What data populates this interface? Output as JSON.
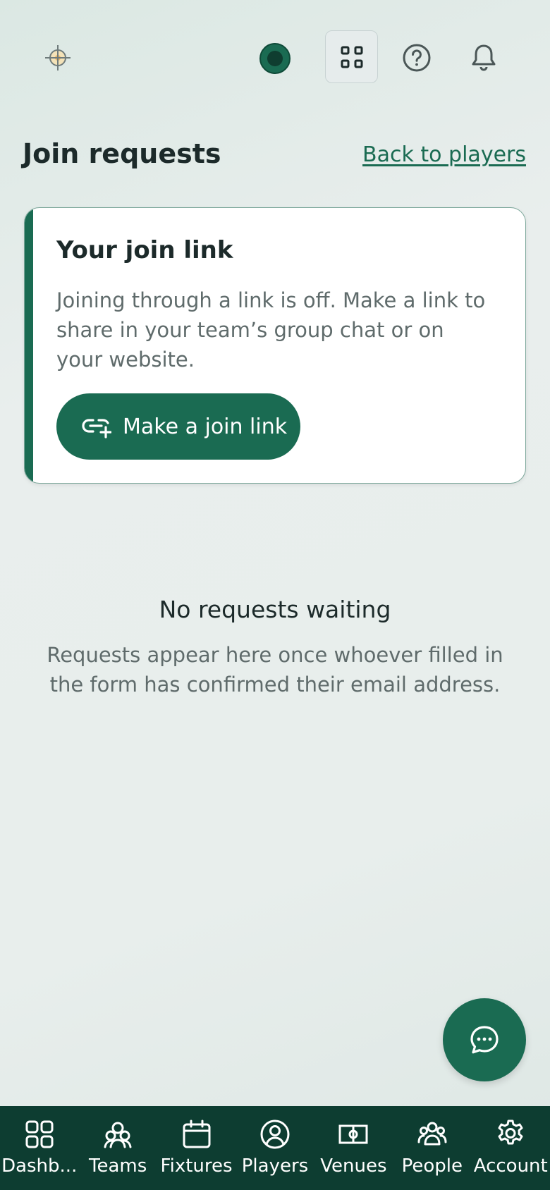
{
  "header": {
    "logo_icon": "crosshair-logo-icon",
    "avatar_icon": "user-avatar",
    "apps_icon": "apps-grid-icon",
    "help_icon": "help-circle-icon",
    "notifications_icon": "bell-icon"
  },
  "page": {
    "title": "Join requests",
    "back_link": "Back to players"
  },
  "join_card": {
    "title": "Your join link",
    "body": "Joining through a link is off. Make a link to share in your team’s group chat or on your website.",
    "button_label": "Make a join link",
    "button_icon": "link-add-icon"
  },
  "empty_state": {
    "title": "No requests waiting",
    "body": "Requests appear here once whoever filled in the form has confirmed their email address."
  },
  "chat_fab": {
    "icon": "chat-bubble-icon"
  },
  "bottom_nav": {
    "items": [
      {
        "label": "Dashb...",
        "icon": "dashboard-icon"
      },
      {
        "label": "Teams",
        "icon": "teams-icon"
      },
      {
        "label": "Fixtures",
        "icon": "calendar-icon"
      },
      {
        "label": "Players",
        "icon": "player-icon"
      },
      {
        "label": "Venues",
        "icon": "pitch-icon"
      },
      {
        "label": "People",
        "icon": "people-icon"
      },
      {
        "label": "Account",
        "icon": "gear-icon"
      }
    ]
  },
  "colors": {
    "brand": "#1a6b52",
    "nav_background": "#0d3d31",
    "text_primary": "#1c2a2a",
    "text_secondary": "#5f6b6b"
  }
}
